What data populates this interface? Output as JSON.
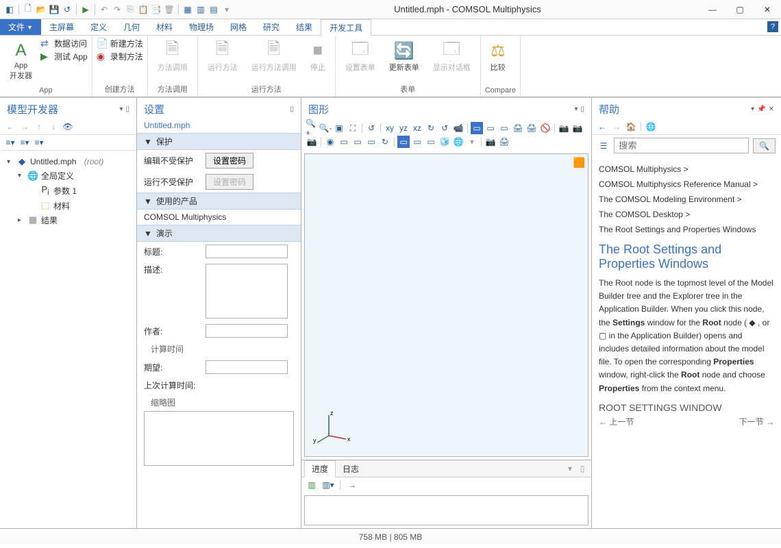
{
  "title": "Untitled.mph - COMSOL Multiphysics",
  "filetab": "文件",
  "tabs": [
    "主屏幕",
    "定义",
    "几何",
    "材料",
    "物理场",
    "网格",
    "研究",
    "结果",
    "开发工具"
  ],
  "active_tab": 8,
  "ribbon": {
    "app": {
      "builder": "App\n开发器",
      "data": "数据访问",
      "test": "测试 App",
      "label": "App"
    },
    "create": {
      "new": "新建方法",
      "rec": "录制方法",
      "label": "创建方法"
    },
    "call": {
      "call": "方法调用",
      "label": "方法调用"
    },
    "run": {
      "run": "运行方法",
      "runcall": "运行方法调用",
      "stop": "停止",
      "label": "运行方法"
    },
    "form": {
      "set": "设置表单",
      "upd": "更新表单",
      "dlg": "显示对话框",
      "label": "表单"
    },
    "cmp": {
      "cmp": "比较",
      "label": "Compare"
    }
  },
  "model_builder": {
    "title": "模型开发器",
    "root": "Untitled.mph",
    "root_suffix": "(root)",
    "items": [
      "全局定义",
      "参数 1",
      "材料",
      "结果"
    ]
  },
  "settings": {
    "title": "设置",
    "subtitle": "Untitled.mph",
    "protect": "保护",
    "edit_unprotected": "编辑不受保护",
    "run_unprotected": "运行不受保护",
    "set_pwd": "设置密码",
    "products": "使用的产品",
    "product_name": "COMSOL Multiphysics",
    "demo": "演示",
    "ftitle": "标题:",
    "fdesc": "描述:",
    "fauthor": "作者:",
    "calctime": "计算时间",
    "fexpect": "期望:",
    "flast": "上次计算时间:",
    "thumb": "缩略图"
  },
  "graphics": {
    "title": "图形"
  },
  "log": {
    "tabs": [
      "进度",
      "日志"
    ],
    "active": 0
  },
  "help": {
    "title": "帮助",
    "search_ph": "搜索",
    "crumbs": [
      "COMSOL Multiphysics  >",
      "COMSOL Multiphysics Reference Manual  >",
      "The COMSOL Modeling Environment  >",
      "The COMSOL Desktop  >",
      "The Root Settings and Properties Windows"
    ],
    "heading": "The Root Settings and Properties Windows",
    "body": "The Root node is the topmost level of the Model Builder tree and the Explorer tree in the Application Builder. When you click this node, the <b>Settings</b> window for the <b>Root</b> node ( ◆ , or ▢ in the Application Builder) opens and includes detailed information about the model file. To open the corresponding <b>Properties</b> window, right-click the <b>Root</b> node and choose <b>Properties</b> from the context menu.",
    "subhead": "ROOT SETTINGS WINDOW",
    "prev": "← 上一节",
    "next": "下一节 →"
  },
  "status": "758 MB | 805 MB"
}
